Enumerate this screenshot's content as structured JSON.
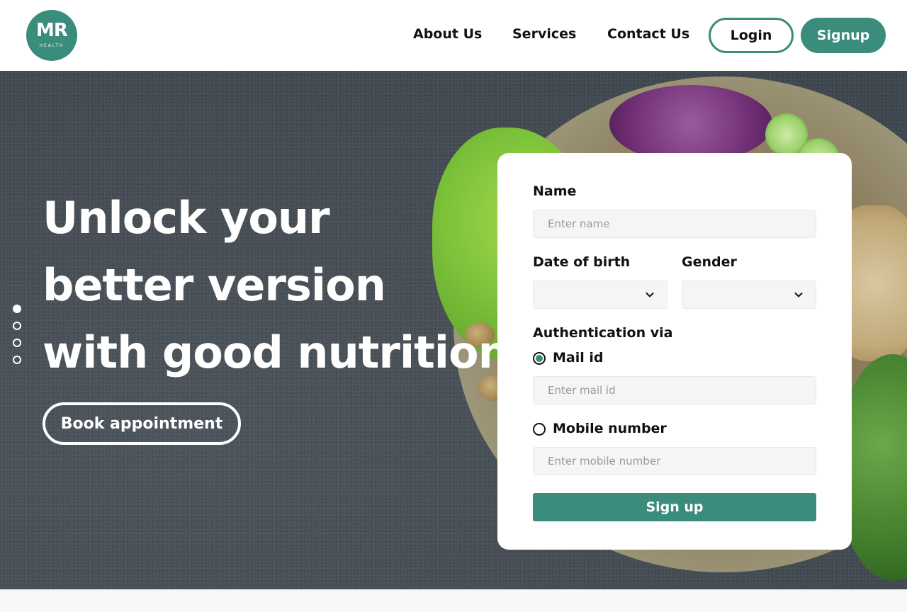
{
  "brand": {
    "logo_text": "MR",
    "logo_sub": "HEALTH",
    "color": "#3a8c7c"
  },
  "nav": {
    "items": [
      {
        "label": "About Us"
      },
      {
        "label": "Services"
      },
      {
        "label": "Contact Us"
      }
    ],
    "login_label": "Login",
    "signup_label": "Signup"
  },
  "hero": {
    "headline_lines": [
      "Unlock your",
      "better version",
      "with good nutrition"
    ],
    "cta_label": "Book appointment",
    "slides": {
      "count": 4,
      "active": 1
    }
  },
  "form": {
    "name_label": "Name",
    "name_placeholder": "Enter name",
    "dob_label": "Date of birth",
    "dob_value": "",
    "gender_label": "Gender",
    "gender_value": "",
    "auth_label": "Authentication via",
    "options": [
      {
        "label": "Mail id",
        "selected": true,
        "placeholder": "Enter mail id"
      },
      {
        "label": "Mobile number",
        "selected": false,
        "placeholder": "Enter mobile number"
      }
    ],
    "submit_label": "Sign up"
  },
  "icons": {
    "select_chevron": "chevron-down-icon",
    "logo": "health-cross-logo-icon"
  }
}
